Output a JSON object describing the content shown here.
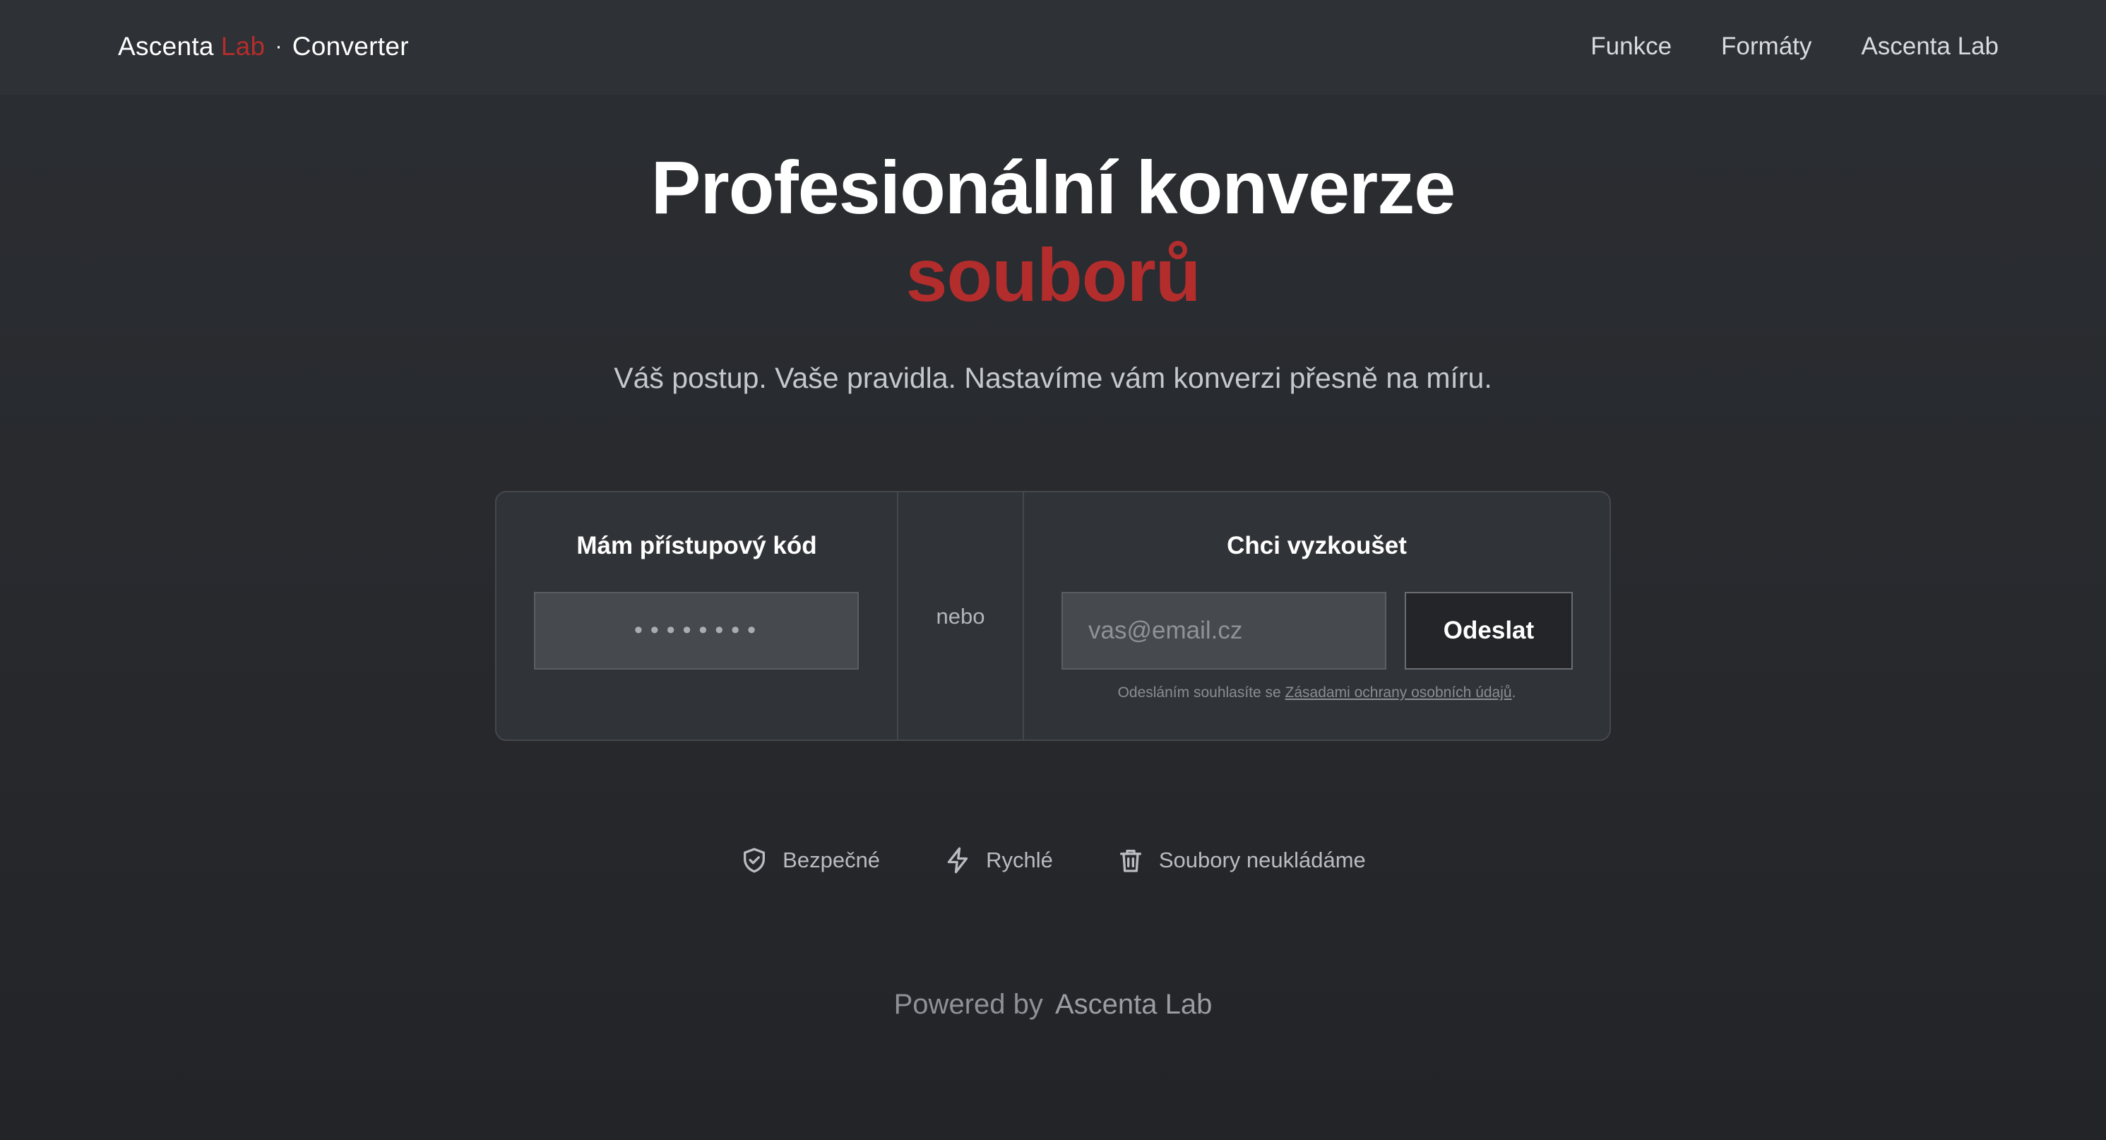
{
  "header": {
    "brand": {
      "name": "Ascenta",
      "lab": "Lab",
      "separator": "·",
      "product": "Converter"
    },
    "nav": [
      {
        "label": "Funkce"
      },
      {
        "label": "Formáty"
      },
      {
        "label": "Ascenta Lab"
      }
    ]
  },
  "hero": {
    "title_line1": "Profesionální konverze",
    "title_line2": "souborů",
    "subtitle": "Váš postup. Vaše pravidla. Nastavíme vám konverzi přesně na míru."
  },
  "access": {
    "heading": "Mám přístupový kód",
    "code_value": "••••••••",
    "divider": "nebo",
    "trial_heading": "Chci vyzkoušet",
    "email_placeholder": "vas@email.cz",
    "submit_label": "Odeslat",
    "consent_prefix": "Odesláním souhlasíte se ",
    "consent_link": "Zásadami ochrany osobních údajů",
    "consent_suffix": "."
  },
  "features": [
    {
      "label": "Bezpečné",
      "icon": "shield-check-icon"
    },
    {
      "label": "Rychlé",
      "icon": "lightning-icon"
    },
    {
      "label": "Soubory neukládáme",
      "icon": "trash-icon"
    }
  ],
  "footer": {
    "powered_prefix": "Powered by",
    "powered_brand": "Ascenta Lab"
  },
  "colors": {
    "accent": "#b32d2d",
    "background": "#2a2d31",
    "card": "#303337"
  }
}
